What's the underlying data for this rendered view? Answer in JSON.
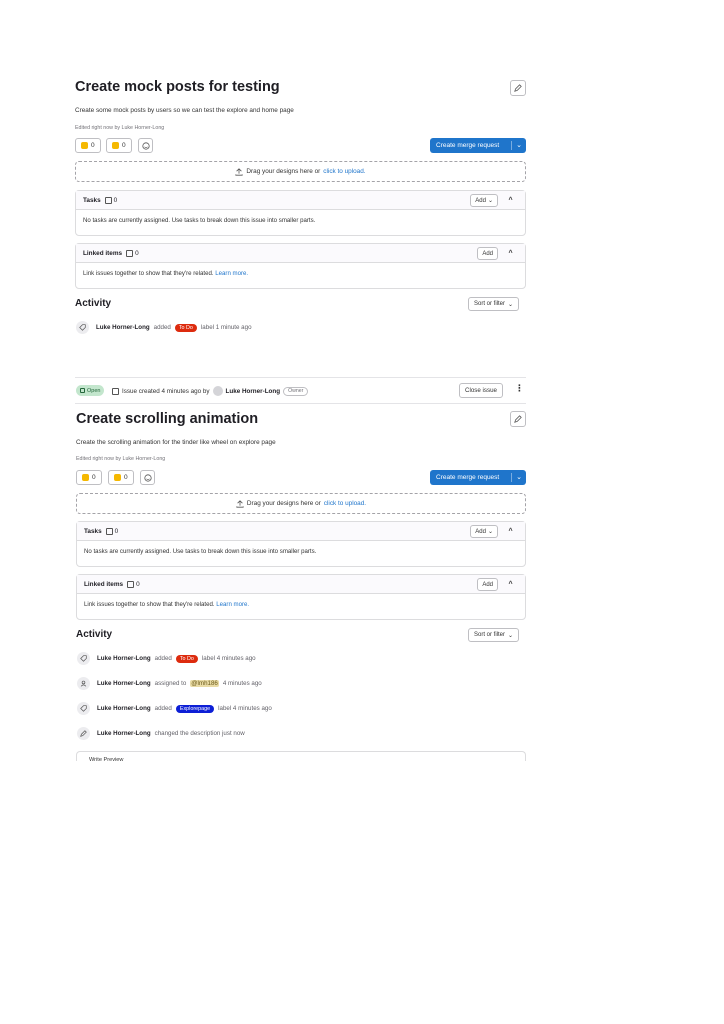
{
  "issue1": {
    "title": "Create mock posts for testing",
    "description": "Create some mock posts by users so we can test the explore and home page",
    "edited": "Edited right now by Luke Horner-Long",
    "thumbs_up": "0",
    "thumbs_down": "0",
    "merge_request_label": "Create merge request",
    "dropzone_text": "Drag your designs here or",
    "dropzone_link": "click to upload.",
    "tasks": {
      "title": "Tasks",
      "count": "0",
      "add_label": "Add",
      "body": "No tasks are currently assigned. Use tasks to break down this issue into smaller parts."
    },
    "linked": {
      "title": "Linked items",
      "count": "0",
      "add_label": "Add",
      "body": "Link issues together to show that they're related.",
      "learn_more": "Learn more."
    },
    "activity_title": "Activity",
    "sort_label": "Sort or filter",
    "activity": [
      {
        "who": "Luke Horner-Long",
        "action": "added",
        "label": "To Do",
        "suffix": "label 1 minute ago"
      }
    ]
  },
  "issue2": {
    "status": "Open",
    "meta_text": "Issue created 4 minutes ago by",
    "author": "Luke Horner-Long",
    "owner_badge": "Owner",
    "close_label": "Close issue",
    "title": "Create scrolling animation",
    "description": "Create the scrolling animation for the tinder like wheel on explore page",
    "edited": "Edited right now by Luke Horner-Long",
    "thumbs_up": "0",
    "thumbs_down": "0",
    "merge_request_label": "Create merge request",
    "dropzone_text": "Drag your designs here or",
    "dropzone_link": "click to upload.",
    "tasks": {
      "title": "Tasks",
      "count": "0",
      "add_label": "Add",
      "body": "No tasks are currently assigned. Use tasks to break down this issue into smaller parts."
    },
    "linked": {
      "title": "Linked items",
      "count": "0",
      "add_label": "Add",
      "body": "Link issues together to show that they're related.",
      "learn_more": "Learn more."
    },
    "activity_title": "Activity",
    "sort_label": "Sort or filter",
    "activity": [
      {
        "who": "Luke Horner-Long",
        "action": "added",
        "label": "To Do",
        "suffix": "label 4 minutes ago"
      },
      {
        "who": "Luke Horner-Long",
        "action": "assigned to",
        "mention": "@lmh186",
        "suffix": "4 minutes ago"
      },
      {
        "who": "Luke Horner-Long",
        "action": "added",
        "label": "Explorepage",
        "suffix": "label 4 minutes ago"
      },
      {
        "who": "Luke Horner-Long",
        "action": "changed the description just now"
      }
    ],
    "write_tabs": "Write   Preview"
  },
  "colors": {
    "todo": "#dd2b0e",
    "explorepage": "#0d1fd6",
    "primary": "#1f75cb"
  }
}
